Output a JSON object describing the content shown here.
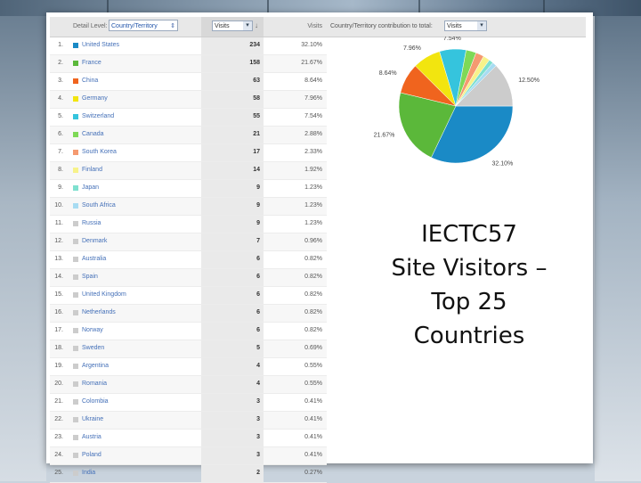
{
  "slide_title": [
    "IECTC57",
    "Site Visitors –",
    "Top 25",
    "Countries"
  ],
  "table": {
    "detail_level_label": "Detail Level:",
    "detail_level_value": "Country/Territory",
    "metric_select_value": "Visits",
    "visits_header": "Visits",
    "rows": [
      {
        "rank": "1.",
        "country": "United States",
        "visits": "234",
        "pct": "32.10%",
        "color": "#1a8ac6"
      },
      {
        "rank": "2.",
        "country": "France",
        "visits": "158",
        "pct": "21.67%",
        "color": "#5bb83a"
      },
      {
        "rank": "3.",
        "country": "China",
        "visits": "63",
        "pct": "8.64%",
        "color": "#f0641e"
      },
      {
        "rank": "4.",
        "country": "Germany",
        "visits": "58",
        "pct": "7.96%",
        "color": "#f2e50f"
      },
      {
        "rank": "5.",
        "country": "Switzerland",
        "visits": "55",
        "pct": "7.54%",
        "color": "#35c4dd"
      },
      {
        "rank": "6.",
        "country": "Canada",
        "visits": "21",
        "pct": "2.88%",
        "color": "#7ed957"
      },
      {
        "rank": "7.",
        "country": "South Korea",
        "visits": "17",
        "pct": "2.33%",
        "color": "#f59a70"
      },
      {
        "rank": "8.",
        "country": "Finland",
        "visits": "14",
        "pct": "1.92%",
        "color": "#f7f28a"
      },
      {
        "rank": "9.",
        "country": "Japan",
        "visits": "9",
        "pct": "1.23%",
        "color": "#7fe0cf"
      },
      {
        "rank": "10.",
        "country": "South Africa",
        "visits": "9",
        "pct": "1.23%",
        "color": "#a8dcf2"
      },
      {
        "rank": "11.",
        "country": "Russia",
        "visits": "9",
        "pct": "1.23%",
        "color": "#cccccc"
      },
      {
        "rank": "12.",
        "country": "Denmark",
        "visits": "7",
        "pct": "0.96%",
        "color": "#cccccc"
      },
      {
        "rank": "13.",
        "country": "Australia",
        "visits": "6",
        "pct": "0.82%",
        "color": "#cccccc"
      },
      {
        "rank": "14.",
        "country": "Spain",
        "visits": "6",
        "pct": "0.82%",
        "color": "#cccccc"
      },
      {
        "rank": "15.",
        "country": "United Kingdom",
        "visits": "6",
        "pct": "0.82%",
        "color": "#cccccc"
      },
      {
        "rank": "16.",
        "country": "Netherlands",
        "visits": "6",
        "pct": "0.82%",
        "color": "#cccccc"
      },
      {
        "rank": "17.",
        "country": "Norway",
        "visits": "6",
        "pct": "0.82%",
        "color": "#cccccc"
      },
      {
        "rank": "18.",
        "country": "Sweden",
        "visits": "5",
        "pct": "0.69%",
        "color": "#cccccc"
      },
      {
        "rank": "19.",
        "country": "Argentina",
        "visits": "4",
        "pct": "0.55%",
        "color": "#cccccc"
      },
      {
        "rank": "20.",
        "country": "Romania",
        "visits": "4",
        "pct": "0.55%",
        "color": "#cccccc"
      },
      {
        "rank": "21.",
        "country": "Colombia",
        "visits": "3",
        "pct": "0.41%",
        "color": "#cccccc"
      },
      {
        "rank": "22.",
        "country": "Ukraine",
        "visits": "3",
        "pct": "0.41%",
        "color": "#cccccc"
      },
      {
        "rank": "23.",
        "country": "Austria",
        "visits": "3",
        "pct": "0.41%",
        "color": "#cccccc"
      },
      {
        "rank": "24.",
        "country": "Poland",
        "visits": "3",
        "pct": "0.41%",
        "color": "#cccccc"
      },
      {
        "rank": "25.",
        "country": "India",
        "visits": "2",
        "pct": "0.27%",
        "color": "#cccccc"
      }
    ]
  },
  "pie_panel": {
    "label": "Country/Territory contribution to total:",
    "select_value": "Visits"
  },
  "chart_data": {
    "type": "pie",
    "slices": [
      {
        "label": "32.10%",
        "value": 32.1,
        "color": "#1a8ac6"
      },
      {
        "label": "21.67%",
        "value": 21.67,
        "color": "#5bb83a"
      },
      {
        "label": "8.64%",
        "value": 8.64,
        "color": "#f0641e"
      },
      {
        "label": "7.96%",
        "value": 7.96,
        "color": "#f2e50f"
      },
      {
        "label": "7.54%",
        "value": 7.54,
        "color": "#35c4dd"
      },
      {
        "label": "",
        "value": 2.88,
        "color": "#7ed957"
      },
      {
        "label": "",
        "value": 2.33,
        "color": "#f59a70"
      },
      {
        "label": "",
        "value": 1.92,
        "color": "#f7f28a"
      },
      {
        "label": "",
        "value": 1.23,
        "color": "#7fe0cf"
      },
      {
        "label": "",
        "value": 1.23,
        "color": "#a8dcf2"
      },
      {
        "label": "12.50%",
        "value": 12.5,
        "color": "#cccccc"
      }
    ]
  }
}
